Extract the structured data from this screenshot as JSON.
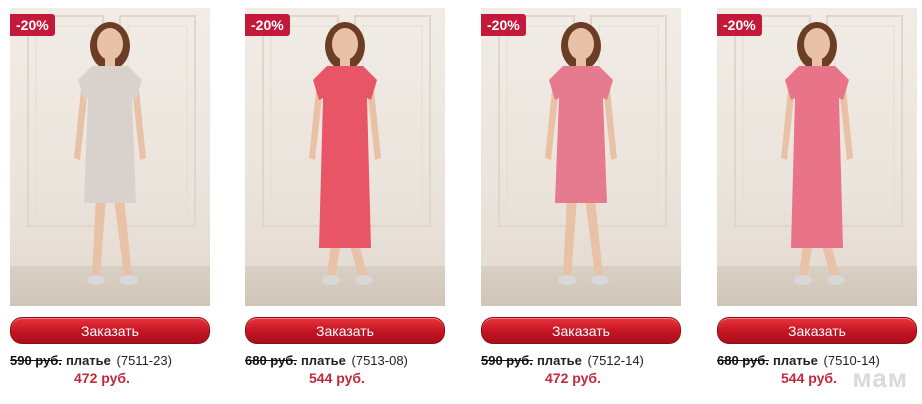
{
  "products": [
    {
      "badge": "-20%",
      "button_label": "Заказать",
      "old_price": "590 руб.",
      "name": "платье",
      "code": "(7511-23)",
      "new_price": "472 руб.",
      "dress_color": "#d9d2cc",
      "dress_style": "short"
    },
    {
      "badge": "-20%",
      "button_label": "Заказать",
      "old_price": "680 руб.",
      "name": "платье",
      "code": "(7513-08)",
      "new_price": "544 руб.",
      "dress_color": "#e85567",
      "dress_style": "long"
    },
    {
      "badge": "-20%",
      "button_label": "Заказать",
      "old_price": "590 руб.",
      "name": "платье",
      "code": "(7512-14)",
      "new_price": "472 руб.",
      "dress_color": "#e67a8e",
      "dress_style": "short"
    },
    {
      "badge": "-20%",
      "button_label": "Заказать",
      "old_price": "680 руб.",
      "name": "платье",
      "code": "(7510-14)",
      "new_price": "544 руб.",
      "dress_color": "#e9748a",
      "dress_style": "long"
    }
  ],
  "watermark": "мам",
  "colors": {
    "accent": "#c4193a",
    "price": "#c02a3c"
  }
}
